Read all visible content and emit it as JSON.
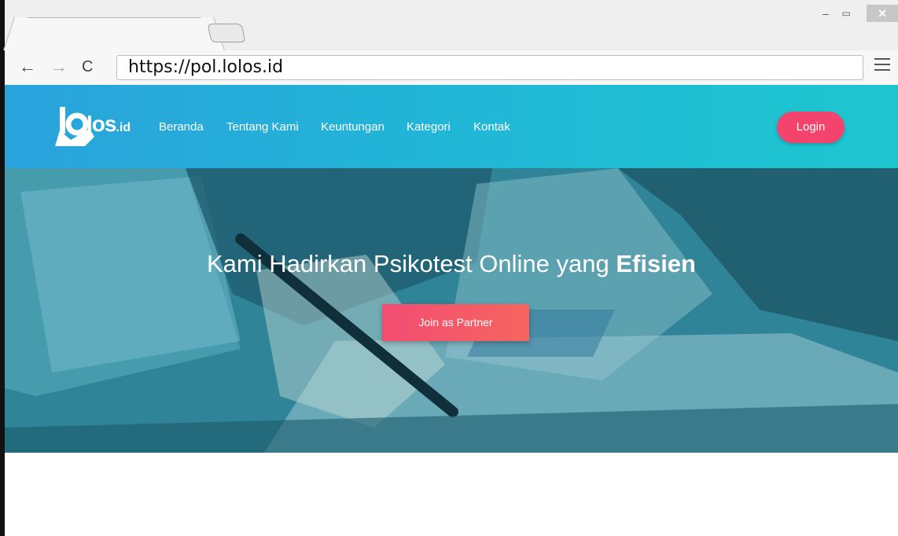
{
  "browser": {
    "url": "https://pol.lolos.id",
    "controls": {
      "minimize": "–",
      "maximize": "▭",
      "close": "✕"
    },
    "icons": {
      "back": "←",
      "forward": "→",
      "reload": "C"
    }
  },
  "site": {
    "logo": {
      "text": "los",
      "suffix": ".id"
    },
    "nav": [
      "Beranda",
      "Tentang Kami",
      "Keuntungan",
      "Kategori",
      "Kontak"
    ],
    "login_label": "Login",
    "hero": {
      "title_prefix": "Kami Hadirkan Psikotest Online yang ",
      "title_emphasis": "Efisien",
      "cta_label": "Join as Partner"
    },
    "colors": {
      "navbar_start": "#2aa3dc",
      "navbar_end": "#1ec6cf",
      "accent": "#f2446d",
      "hero_overlay": "#3d96a8"
    }
  }
}
